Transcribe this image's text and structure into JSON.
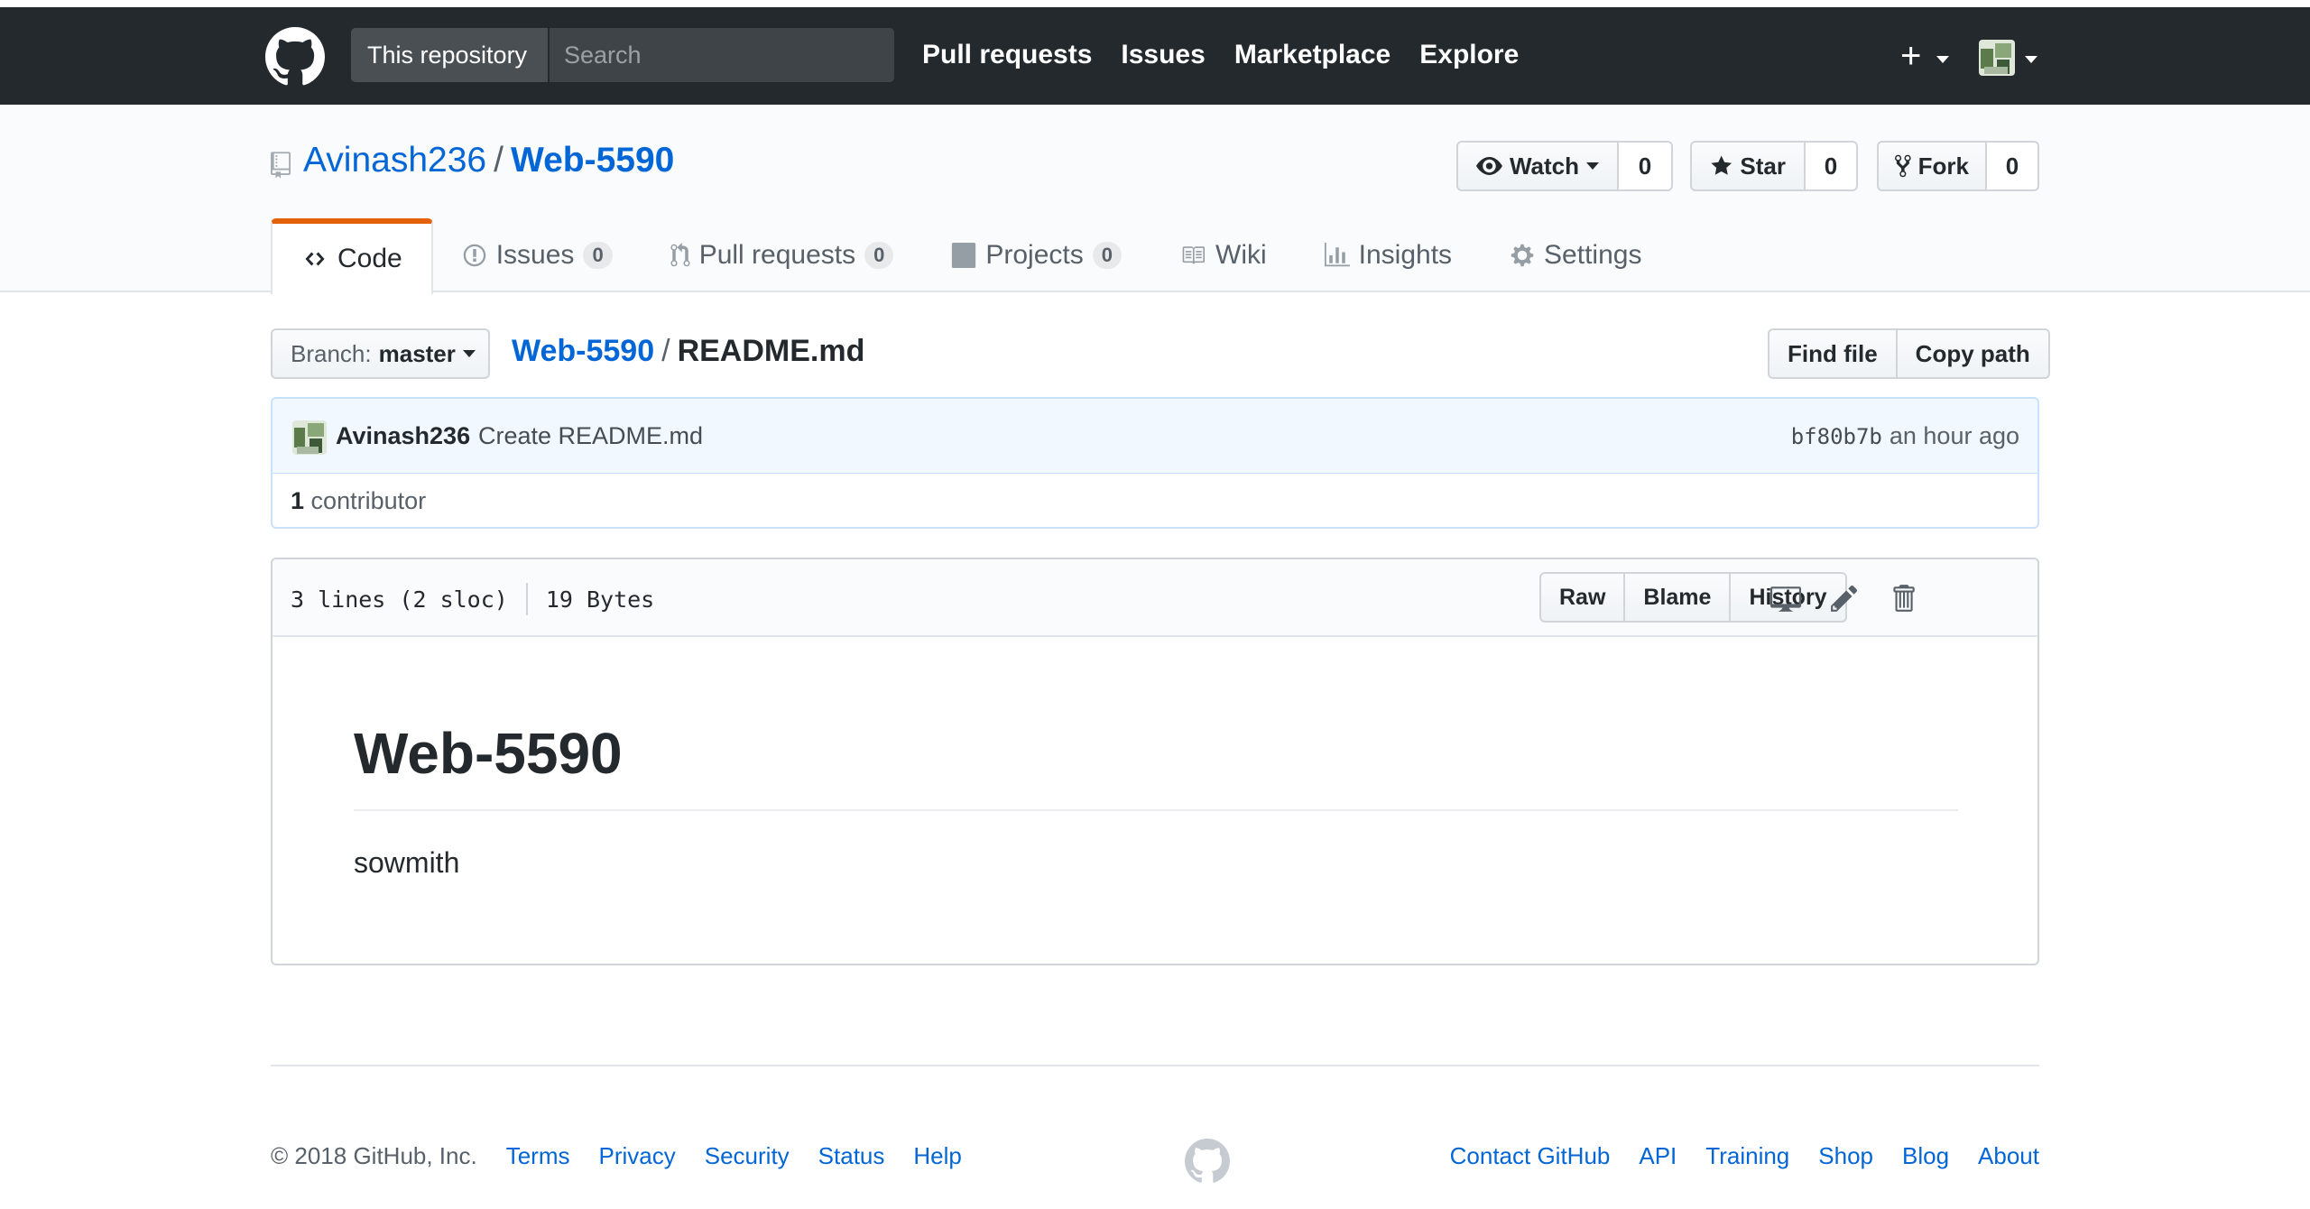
{
  "header": {
    "search_scope": "This repository",
    "search_placeholder": "Search",
    "nav": [
      "Pull requests",
      "Issues",
      "Marketplace",
      "Explore"
    ],
    "plus_label": "+"
  },
  "repo": {
    "owner": "Avinash236",
    "separator": "/",
    "name": "Web-5590",
    "actions": {
      "watch_label": "Watch",
      "watch_count": "0",
      "star_label": "Star",
      "star_count": "0",
      "fork_label": "Fork",
      "fork_count": "0"
    },
    "tabs": [
      {
        "label": "Code",
        "icon": "code-icon"
      },
      {
        "label": "Issues",
        "count": "0",
        "icon": "issue-opened-icon"
      },
      {
        "label": "Pull requests",
        "count": "0",
        "icon": "git-pull-request-icon"
      },
      {
        "label": "Projects",
        "count": "0",
        "icon": "project-icon"
      },
      {
        "label": "Wiki",
        "icon": "book-icon"
      },
      {
        "label": "Insights",
        "icon": "graph-icon"
      },
      {
        "label": "Settings",
        "icon": "gear-icon"
      }
    ]
  },
  "file_nav": {
    "branch_prefix": "Branch:",
    "branch": "master",
    "breadcrumb_root": "Web-5590",
    "breadcrumb_sep": "/",
    "breadcrumb_file": "README.md",
    "find_file": "Find file",
    "copy_path": "Copy path"
  },
  "commit": {
    "author": "Avinash236",
    "message": "Create README.md",
    "sha": "bf80b7b",
    "time": "an hour ago"
  },
  "contributors": {
    "count": "1",
    "label": "contributor"
  },
  "file": {
    "lines": "3 lines (2 sloc)",
    "size": "19 Bytes",
    "actions": [
      "Raw",
      "Blame",
      "History"
    ]
  },
  "readme": {
    "heading": "Web-5590",
    "paragraph": "sowmith"
  },
  "footer": {
    "copyright": "© 2018 GitHub, Inc.",
    "left_links": [
      "Terms",
      "Privacy",
      "Security",
      "Status",
      "Help"
    ],
    "right_links": [
      "Contact GitHub",
      "API",
      "Training",
      "Shop",
      "Blog",
      "About"
    ]
  },
  "colors": {
    "header_bg": "#24292e",
    "link": "#0366d6",
    "tab_accent": "#e36209",
    "commit_bg": "#f1f8ff"
  }
}
